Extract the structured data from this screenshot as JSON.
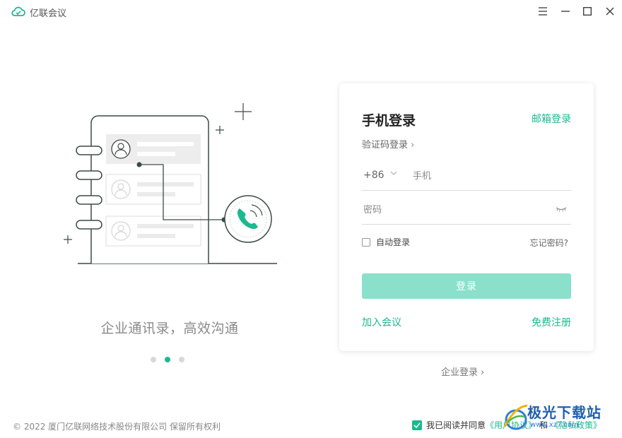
{
  "app": {
    "title": "亿联会议"
  },
  "illustration": {
    "slogan": "企业通讯录，高效沟通",
    "slide_count": 3,
    "active_slide": 2
  },
  "login": {
    "title": "手机登录",
    "email_login": "邮箱登录",
    "code_login": "验证码登录",
    "country_code": "+86",
    "phone_placeholder": "手机",
    "password_placeholder": "密码",
    "auto_login": "自动登录",
    "forgot_password": "忘记密码?",
    "login_button": "登录",
    "join_meeting": "加入会议",
    "register": "免费注册"
  },
  "enterprise_login": "企业登录",
  "footer": {
    "copyright": "© 2022 厦门亿联网络技术股份有限公司 保留所有权利",
    "agree_text": "我已阅读并同意",
    "user_agreement": "《用户协议》",
    "and": "和",
    "privacy_policy": "《隐私政策》"
  },
  "watermark": {
    "text": "极光下载站",
    "url": "www.xz7.com"
  },
  "colors": {
    "accent": "#1db88f",
    "button_disabled": "#8ae0cb"
  }
}
